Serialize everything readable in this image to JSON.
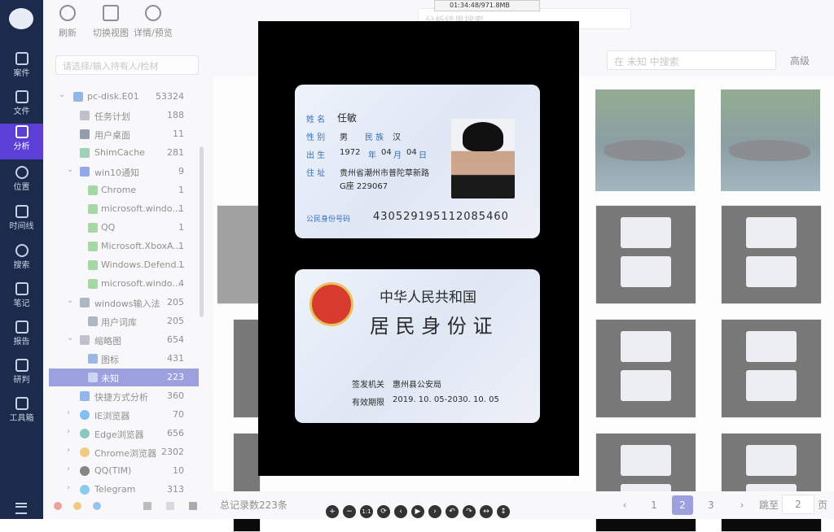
{
  "toolbar": {
    "refresh": "刷新",
    "switch_view": "切换视图",
    "details": "详情/预览"
  },
  "rail": [
    {
      "label": "案件"
    },
    {
      "label": "文件"
    },
    {
      "label": "分析"
    },
    {
      "label": "位置"
    },
    {
      "label": "时间线"
    },
    {
      "label": "搜索"
    },
    {
      "label": "笔记"
    },
    {
      "label": "报告"
    },
    {
      "label": "研判"
    },
    {
      "label": "工具箱"
    }
  ],
  "filter": {
    "placeholder": "请选择/输入持有人/检材"
  },
  "top_search": {
    "placeholder": "分析结果搜索"
  },
  "grid_search": {
    "placeholder": "在 未知 中搜索",
    "advanced": "高级"
  },
  "tree": [
    {
      "label": "pc-disk.E01",
      "count": "53324"
    },
    {
      "label": "任务计划",
      "count": "188"
    },
    {
      "label": "用户桌面",
      "count": "11"
    },
    {
      "label": "ShimCache",
      "count": "281"
    },
    {
      "label": "win10通知",
      "count": "9"
    },
    {
      "label": "Chrome",
      "count": "1"
    },
    {
      "label": "microsoft.windo...",
      "count": "1"
    },
    {
      "label": "QQ",
      "count": "1"
    },
    {
      "label": "Microsoft.XboxA...",
      "count": "1"
    },
    {
      "label": "Windows.Defend...",
      "count": "1"
    },
    {
      "label": "microsoft.windo...",
      "count": "4"
    },
    {
      "label": "windows输入法",
      "count": "205"
    },
    {
      "label": "用户词库",
      "count": "205"
    },
    {
      "label": "缩略图",
      "count": "654"
    },
    {
      "label": "图标",
      "count": "431"
    },
    {
      "label": "未知",
      "count": "223"
    },
    {
      "label": "快捷方式分析",
      "count": "360"
    },
    {
      "label": "IE浏览器",
      "count": "70"
    },
    {
      "label": "Edge浏览器",
      "count": "656"
    },
    {
      "label": "Chrome浏览器",
      "count": "2302"
    },
    {
      "label": "QQ(TIM)",
      "count": "10"
    },
    {
      "label": "Telegram",
      "count": "313"
    }
  ],
  "pager": {
    "total": "总记录数223条",
    "pages": [
      "1",
      "2",
      "3"
    ],
    "current": "2",
    "jump_label": "跳至",
    "jump_value": "2",
    "page_suffix": "页"
  },
  "badge": {
    "text": "01:34:48/971.8MB"
  },
  "idcard_front": {
    "name_key": "姓  名",
    "name": "任敏",
    "sex_key": "性  别",
    "sex": "男",
    "nation_key": "民  族",
    "nation": "汉",
    "birth_key": "出  生",
    "birth_y": "1972",
    "y": "年",
    "birth_m": "04",
    "m": "月",
    "birth_d": "04",
    "d": "日",
    "addr_key": "住  址",
    "addr1": "贵州省潮州市普陀草新路",
    "addr2": "G座 229067",
    "id_key": "公民身份号码",
    "id": "430529195112085460"
  },
  "idcard_back": {
    "title1": "中华人民共和国",
    "title2": "居 民 身 份 证",
    "auth_key": "签发机关",
    "auth": "惠州县公安局",
    "valid_key": "有效期限",
    "valid": "2019. 10. 05-2030. 10. 05"
  },
  "viewer_controls": [
    "+",
    "−",
    "1:1",
    "⟳",
    "‹",
    "▶",
    "›",
    "↶",
    "↷",
    "↔",
    "↕"
  ]
}
